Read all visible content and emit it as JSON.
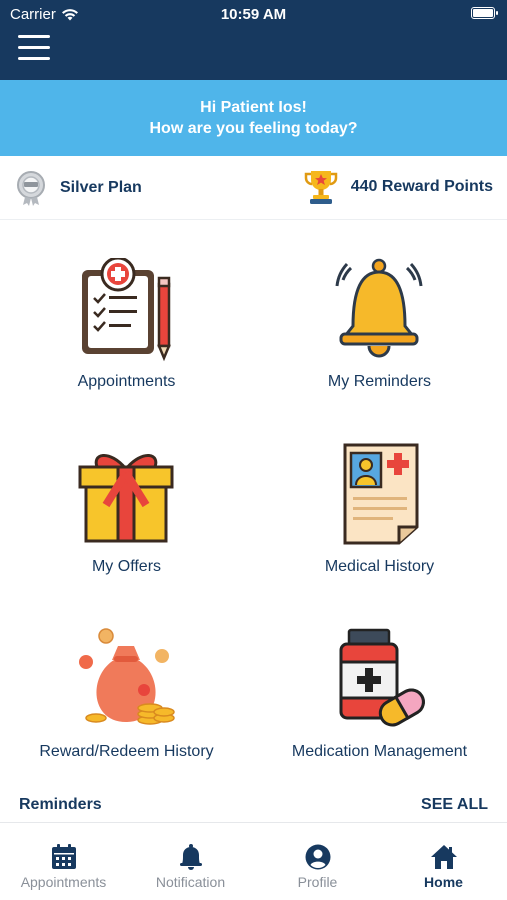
{
  "status_bar": {
    "carrier": "Carrier",
    "time": "10:59 AM"
  },
  "greeting": {
    "line1": "Hi Patient Ios!",
    "line2": "How are you feeling today?"
  },
  "plan": {
    "name": "Silver Plan",
    "reward_points": "440 Reward Points"
  },
  "tiles": [
    {
      "label": "Appointments",
      "icon": "clipboard-icon"
    },
    {
      "label": "My Reminders",
      "icon": "bell-icon"
    },
    {
      "label": "My Offers",
      "icon": "gift-icon"
    },
    {
      "label": "Medical History",
      "icon": "medical-record-icon"
    },
    {
      "label": "Reward/Redeem History",
      "icon": "money-bag-icon"
    },
    {
      "label": "Medication Management",
      "icon": "medicine-bottle-icon"
    }
  ],
  "reminders": {
    "title": "Reminders",
    "see_all": "SEE ALL"
  },
  "tabbar": [
    {
      "label": "Appointments",
      "icon": "calendar-icon"
    },
    {
      "label": "Notification",
      "icon": "bell-icon"
    },
    {
      "label": "Profile",
      "icon": "user-icon"
    },
    {
      "label": "Home",
      "icon": "home-icon",
      "active": true
    }
  ],
  "colors": {
    "navy": "#17395f",
    "banner": "#4fb5ea",
    "inactive_tab": "#8a9099"
  }
}
